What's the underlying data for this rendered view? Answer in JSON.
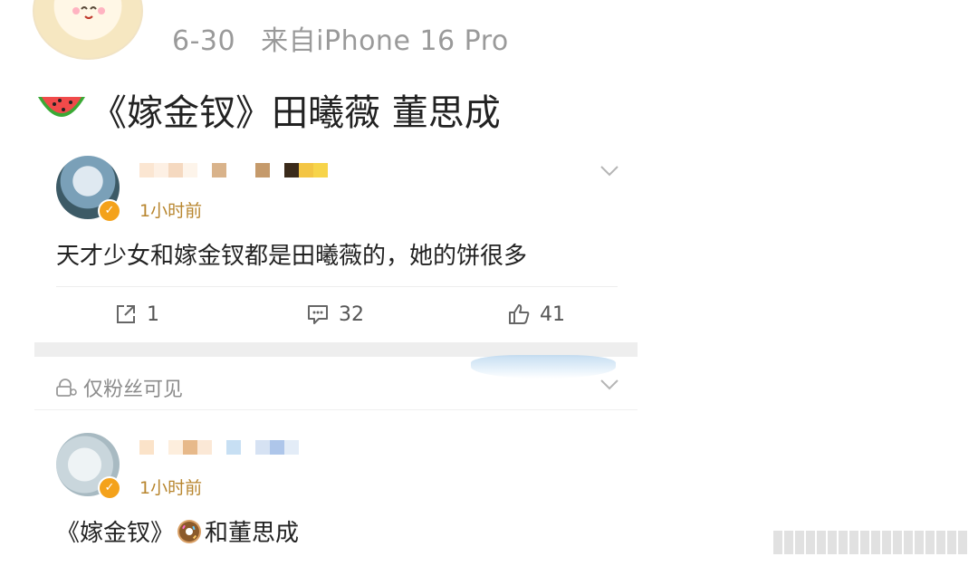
{
  "post": {
    "date": "6-30",
    "source": "来自iPhone 16 Pro",
    "title_emoji": "watermelon",
    "title": "《嫁金钗》田曦薇 董思成"
  },
  "comments": [
    {
      "time": "1小时前",
      "text": "天才少女和嫁金钗都是田曦薇的，她的饼很多",
      "actions": {
        "repost": "1",
        "comment": "32",
        "like": "41"
      }
    },
    {
      "time": "1小时前",
      "text_before": "《嫁金钗》",
      "text_emoji": "donut",
      "text_after": "和董思成"
    }
  ],
  "visibility": {
    "label": "仅粉丝可见"
  },
  "icons": {
    "repost": "repost-icon",
    "comment": "comment-icon",
    "like": "like-icon",
    "expand": "chevron-down-icon",
    "visibility": "lock-user-icon",
    "verified": "verified-badge-icon"
  },
  "colors": {
    "verified": "#f4a21b",
    "time_text": "#b8862f",
    "meta_text": "#9a9a9a"
  }
}
